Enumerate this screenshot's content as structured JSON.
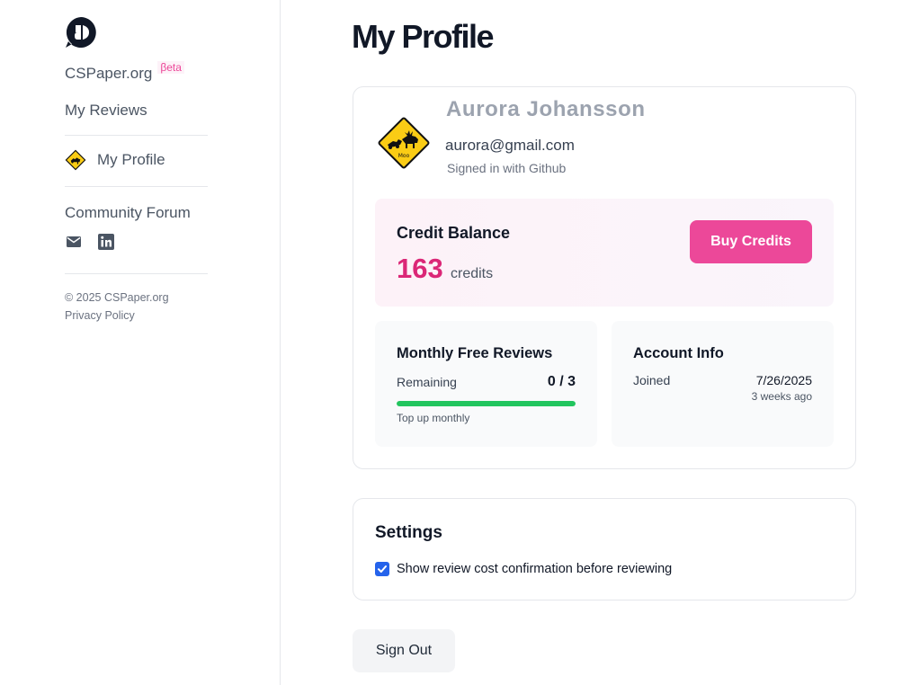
{
  "sidebar": {
    "brand": "CSPaper.org",
    "beta": "βeta",
    "nav_reviews": "My Reviews",
    "nav_profile": "My Profile",
    "forum": "Community Forum",
    "copyright": "© 2025 CSPaper.org",
    "privacy": "Privacy Policy",
    "icons": [
      "logo-icon",
      "mail-icon",
      "linkedin-icon",
      "avatar"
    ]
  },
  "main": {
    "title": "My Profile",
    "profile": {
      "name": "Aurora Johansson",
      "email": "aurora@gmail.com",
      "signin": "Signed in with Github",
      "avatar_text": "Moo"
    },
    "credits": {
      "label": "Credit Balance",
      "value": "163",
      "unit": "credits",
      "buy_label": "Buy Credits",
      "accent": "#ec4899"
    },
    "monthly": {
      "title": "Monthly Free Reviews",
      "remaining_label": "Remaining",
      "remaining_value": "0 / 3",
      "progress": 1.0,
      "note": "Top up monthly",
      "bar_color": "#22c55e"
    },
    "account": {
      "title": "Account Info",
      "joined_label": "Joined",
      "joined_date": "7/26/2025",
      "joined_ago": "3 weeks ago"
    },
    "settings": {
      "title": "Settings",
      "confirm_label": "Show review cost confirmation before reviewing",
      "confirm_checked": true
    },
    "signout_label": "Sign Out"
  }
}
